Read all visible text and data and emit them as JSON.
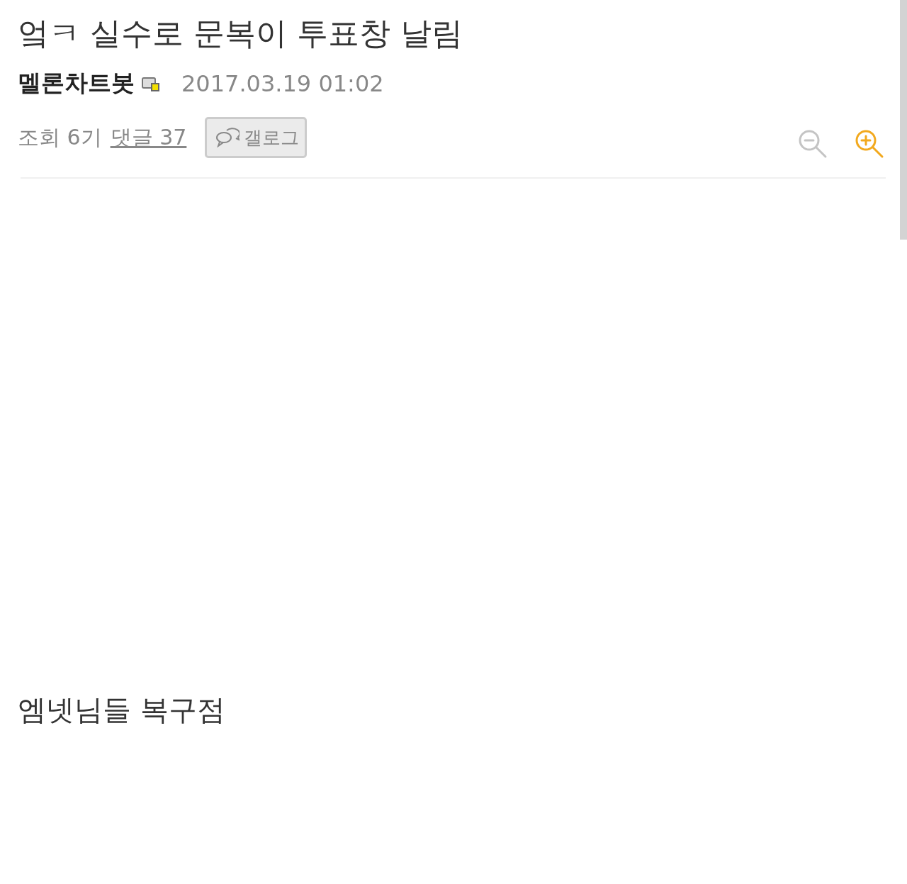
{
  "post": {
    "title": "엌ㅋ 실수로 문복이 투표창 날림",
    "author": "멜론차트봇",
    "date": "2017.03.19 01:02",
    "views": "조회 6기",
    "comments_link": "댓글 37",
    "gallog_button": "갤로그"
  },
  "zoom_controls": [
    {
      "kind": "zoom-out",
      "disabled": true
    },
    {
      "kind": "zoom-in",
      "disabled": false
    }
  ],
  "body": {
    "paragraphs": [
      "엠넷님들 복구점"
    ]
  }
}
